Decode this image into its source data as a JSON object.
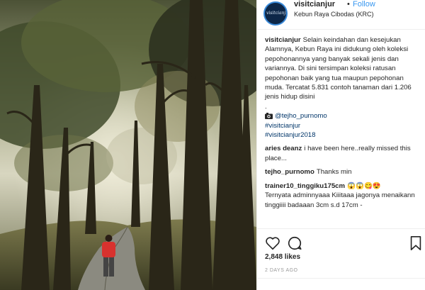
{
  "header": {
    "avatar_text": "visitcianjur",
    "username": "visitcianjur",
    "separator": "•",
    "follow_label": "Follow",
    "location": "Kebun Raya Cibodas (KRC)"
  },
  "caption": {
    "username": "visitcianjur",
    "text": "Selain keindahan dan kesejukan Alamnya, Kebun Raya ini didukung oleh koleksi pepohonannya yang banyak sekali jenis dan variannya. Di sini tersimpan koleksi ratusan pepohonan baik yang tua maupun pepohonan muda. Tercatat 5.831 contoh tanaman dari 1.206 jenis hidup disini",
    "dot": ".",
    "credit": "@tejho_purnomo",
    "hashtag1": "#visitcianjur",
    "hashtag2": "#visitcianjur2018"
  },
  "comments": [
    {
      "username": "aries deanz",
      "text": "i have been here..really missed this place..."
    },
    {
      "username": "tejho_purnomo",
      "text": "Thanks min"
    },
    {
      "username": "trainer10_tinggiku175cm",
      "emoji": "😱😱😋😍",
      "text": "Ternyata adminnyaaa Kiiitaaa jagonya menaikann tinggiiii badaaan 3cm s.d 17cm -"
    }
  ],
  "icons": {
    "like": "heart-icon",
    "comment": "comment-icon",
    "save": "bookmark-icon",
    "credit": "camera-icon"
  },
  "likes": "2,848 likes",
  "time": "2 DAYS AGO",
  "colors": {
    "link": "#3897f0",
    "hashtag": "#003569",
    "muted": "#999999",
    "avatar_bg": "#0d2748"
  }
}
